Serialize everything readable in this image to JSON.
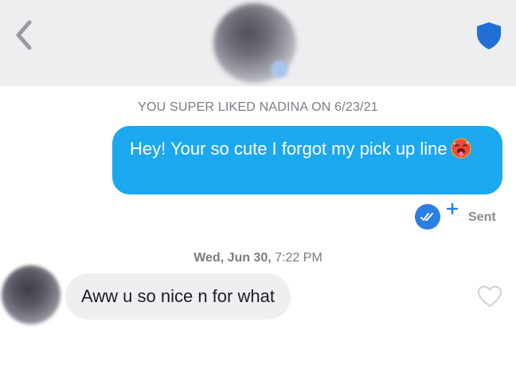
{
  "header": {
    "back_icon": "chevron-left-icon",
    "safety_icon": "shield-icon",
    "shield_color": "#1f6fd6"
  },
  "conversation": {
    "super_like_notice": "YOU SUPER LIKED NADINA ON 6/23/21",
    "sent_message": {
      "text": "Hey! Your so cute I forgot my pick up line",
      "emoji": "hot-face-emoji",
      "bubble_color": "#1ca8ef"
    },
    "read_receipt": {
      "icon": "double-check-icon",
      "plus_icon": "plus-icon",
      "status": "Sent",
      "color": "#2b7fe3"
    },
    "timestamp": {
      "date": "Wed, Jun 30,",
      "time": "7:22 PM"
    },
    "received_message": {
      "text": "Aww u so nice n for what",
      "like_icon": "heart-outline-icon",
      "bubble_color": "#efeff2"
    }
  }
}
